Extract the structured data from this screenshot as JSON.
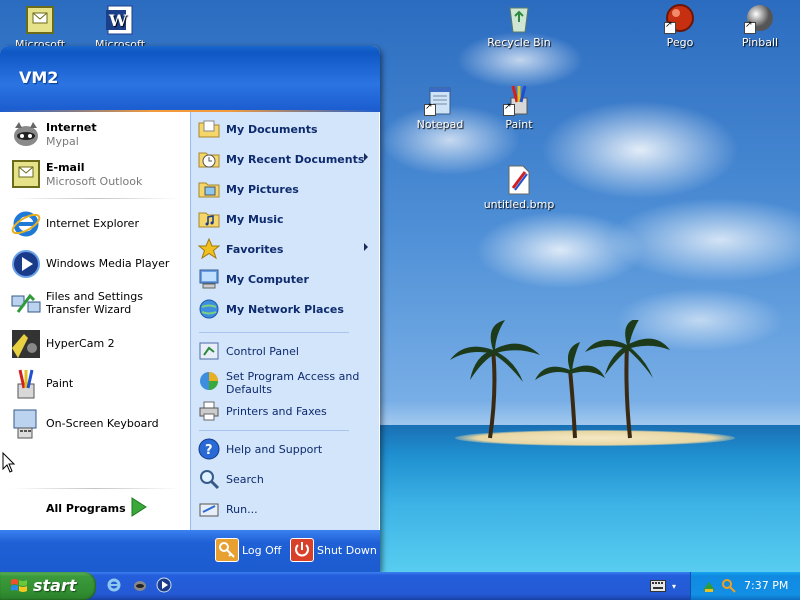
{
  "desktop": {
    "icons": [
      {
        "label": "Microsoft",
        "icon": "outlook-icon"
      },
      {
        "label": "Microsoft Word",
        "icon": "word-icon"
      },
      {
        "label": "Recycle Bin",
        "icon": "recycle-bin-icon"
      },
      {
        "label": "Pego",
        "icon": "pego-icon"
      },
      {
        "label": "Pinball",
        "icon": "pinball-icon"
      },
      {
        "label": "Notepad",
        "icon": "notepad-icon"
      },
      {
        "label": "Paint",
        "icon": "paint-icon"
      },
      {
        "label": "untitled.bmp",
        "icon": "bitmap-file-icon"
      }
    ]
  },
  "start_menu": {
    "user_name": "VM2",
    "pinned": [
      {
        "title": "Internet",
        "subtitle": "Mypal",
        "icon": "mypal-raccoon-icon"
      },
      {
        "title": "E-mail",
        "subtitle": "Microsoft Outlook",
        "icon": "outlook-icon"
      }
    ],
    "recent": [
      {
        "label": "Internet Explorer",
        "icon": "internet-explorer-icon"
      },
      {
        "label": "Windows Media Player",
        "icon": "media-player-icon"
      },
      {
        "label": "Files and Settings Transfer Wizard",
        "icon": "transfer-wizard-icon"
      },
      {
        "label": "HyperCam 2",
        "icon": "hypercam-icon"
      },
      {
        "label": "Paint",
        "icon": "paint-icon"
      },
      {
        "label": "On-Screen Keyboard",
        "icon": "onscreen-keyboard-icon"
      }
    ],
    "all_programs": "All Programs",
    "places": [
      {
        "label": "My Documents",
        "icon": "folder-documents-icon",
        "submenu": false
      },
      {
        "label": "My Recent Documents",
        "icon": "recent-documents-icon",
        "submenu": true
      },
      {
        "label": "My Pictures",
        "icon": "folder-pictures-icon",
        "submenu": false
      },
      {
        "label": "My Music",
        "icon": "folder-music-icon",
        "submenu": false
      },
      {
        "label": "Favorites",
        "icon": "favorites-star-icon",
        "submenu": true
      },
      {
        "label": "My Computer",
        "icon": "computer-icon",
        "submenu": false
      },
      {
        "label": "My Network Places",
        "icon": "network-icon",
        "submenu": false
      }
    ],
    "system": [
      {
        "label": "Control Panel",
        "icon": "control-panel-icon"
      },
      {
        "label": "Set Program Access and Defaults",
        "icon": "program-defaults-icon"
      },
      {
        "label": "Printers and Faxes",
        "icon": "printer-icon"
      }
    ],
    "help": [
      {
        "label": "Help and Support",
        "icon": "help-icon"
      },
      {
        "label": "Search",
        "icon": "search-icon"
      },
      {
        "label": "Run...",
        "icon": "run-icon"
      }
    ],
    "log_off": "Log Off",
    "shut_down": "Shut Down"
  },
  "taskbar": {
    "start_label": "start",
    "quick_launch": [
      "internet-explorer-icon",
      "mypal-icon",
      "media-player-icon"
    ],
    "clock": "7:37 PM"
  },
  "colors": {
    "taskbar_blue": "#245edc",
    "start_green": "#3c9a3c",
    "tray_blue": "#0f8ae0",
    "menu_right_pane": "#d3e5fa"
  }
}
